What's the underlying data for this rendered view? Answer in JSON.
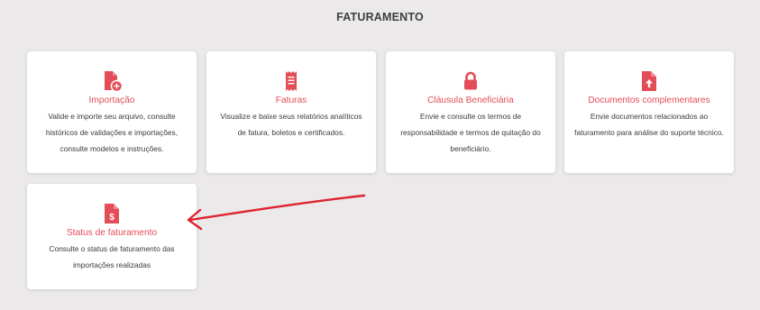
{
  "page": {
    "section_title": "FATURAMENTO"
  },
  "colors": {
    "accent": "#e34d57",
    "arrow": "#e0222e",
    "background": "#ebe9ea",
    "card": "#ffffff"
  },
  "cards": [
    {
      "icon": "file-add-icon",
      "title": "Importação",
      "description": "Valide e importe seu arquivo, consulte históricos de validações e importações, consulte modelos e instruções."
    },
    {
      "icon": "receipt-icon",
      "title": "Faturas",
      "description": "Visualize e baixe seus relatórios analíticos de fatura, boletos e certificados."
    },
    {
      "icon": "lock-icon",
      "title": "Cláusula Beneficiária",
      "description": "Envie e consulte os termos de responsabilidade e termos de quitação do beneficiário."
    },
    {
      "icon": "file-upload-icon",
      "title": "Documentos complementares",
      "description": "Envie documentos relacionados ao faturamento para análise do suporte técnico."
    },
    {
      "icon": "file-dollar-icon",
      "title": "Status de faturamento",
      "description": "Consulte o status de faturamento das importações realizadas"
    }
  ]
}
